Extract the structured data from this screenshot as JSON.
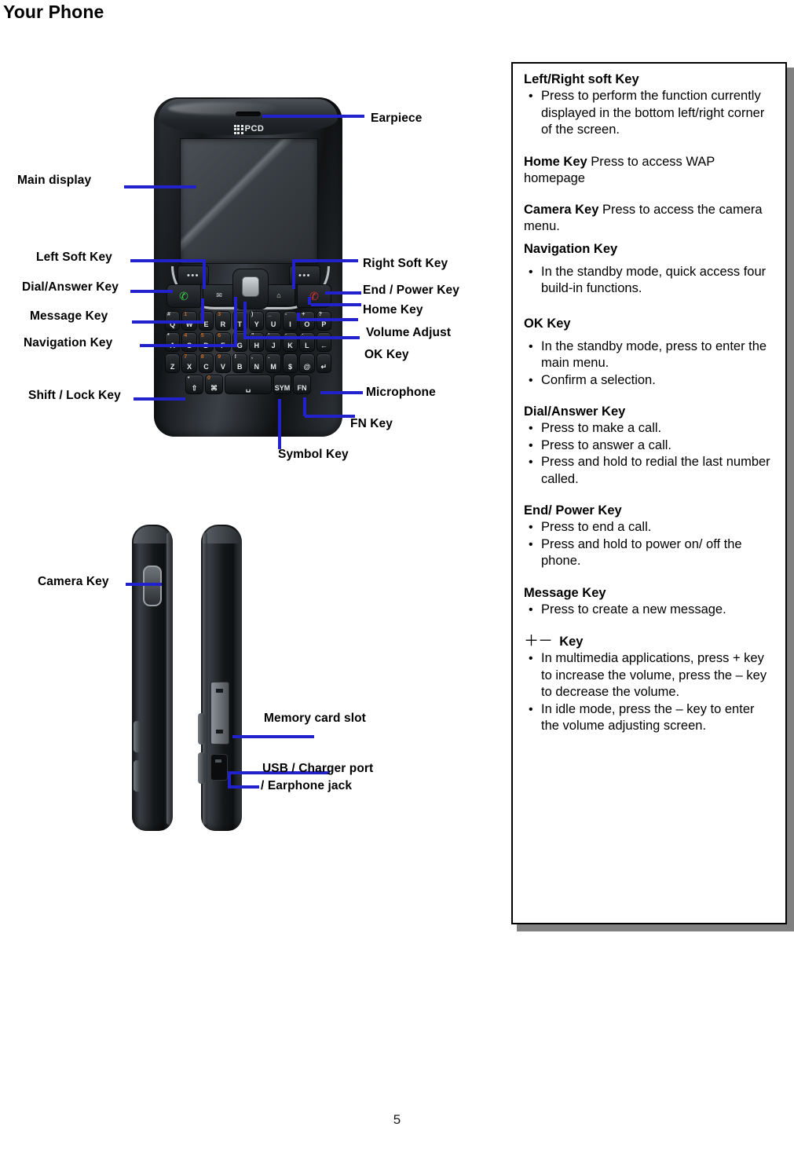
{
  "page": {
    "title": "Your Phone",
    "page_number": "5"
  },
  "phone_brand": "PCD",
  "front_callouts": [
    {
      "label": "Earpiece"
    },
    {
      "label": "Main display"
    },
    {
      "label": "Left Soft Key"
    },
    {
      "label": "Dial/Answer Key"
    },
    {
      "label": "Message Key"
    },
    {
      "label": "Navigation Key"
    },
    {
      "label": "Shift / Lock Key"
    },
    {
      "label": "Right Soft Key"
    },
    {
      "label": "End / Power Key"
    },
    {
      "label": "Home Key"
    },
    {
      "label": "Volume Adjust"
    },
    {
      "label": "OK Key"
    },
    {
      "label": "Microphone"
    },
    {
      "label": "FN Key"
    },
    {
      "label": "Symbol Key"
    }
  ],
  "side_callouts": [
    {
      "label": "Camera Key"
    },
    {
      "label": "Memory card slot"
    },
    {
      "label": "USB / Charger port"
    },
    {
      "label": "/ Earphone jack"
    }
  ],
  "keyboard": {
    "row1": [
      {
        "alt": "#",
        "alt_color": "white",
        "main": "Q"
      },
      {
        "alt": "1",
        "alt_color": "orange",
        "main": "W"
      },
      {
        "alt": "2",
        "alt_color": "orange",
        "main": "E"
      },
      {
        "alt": "3",
        "alt_color": "orange",
        "main": "R"
      },
      {
        "alt": "(",
        "alt_color": "white",
        "main": "T"
      },
      {
        "alt": ")",
        "alt_color": "white",
        "main": "Y"
      },
      {
        "alt": "_",
        "alt_color": "white",
        "main": "U"
      },
      {
        "alt": "-",
        "alt_color": "white",
        "main": "I"
      },
      {
        "alt": "+",
        "alt_color": "white",
        "main": "O"
      },
      {
        "alt": "?",
        "alt_color": "white",
        "main": "P"
      }
    ],
    "row2": [
      {
        "alt": "*",
        "alt_color": "white",
        "main": "A"
      },
      {
        "alt": "4",
        "alt_color": "orange",
        "main": "S"
      },
      {
        "alt": "5",
        "alt_color": "orange",
        "main": "D"
      },
      {
        "alt": "6",
        "alt_color": "orange",
        "main": "F"
      },
      {
        "alt": "/",
        "alt_color": "white",
        "main": "G"
      },
      {
        "alt": "\"",
        "alt_color": "white",
        "main": "H"
      },
      {
        "alt": "'",
        "alt_color": "white",
        "main": "J"
      },
      {
        "alt": ":",
        "alt_color": "white",
        "main": "K"
      },
      {
        "alt": ";",
        "alt_color": "white",
        "main": "L"
      },
      {
        "alt": "",
        "alt_color": "white",
        "main": "←"
      }
    ],
    "row3": [
      {
        "alt": "",
        "alt_color": "white",
        "main": "Z"
      },
      {
        "alt": "7",
        "alt_color": "orange",
        "main": "X"
      },
      {
        "alt": "8",
        "alt_color": "orange",
        "main": "C"
      },
      {
        "alt": "9",
        "alt_color": "orange",
        "main": "V"
      },
      {
        "alt": "!",
        "alt_color": "white",
        "main": "B"
      },
      {
        "alt": ",",
        "alt_color": "white",
        "main": "N"
      },
      {
        "alt": ".",
        "alt_color": "white",
        "main": "M"
      },
      {
        "alt": "",
        "alt_color": "white",
        "main": "$"
      },
      {
        "alt": "",
        "alt_color": "white",
        "main": "@"
      },
      {
        "alt": "",
        "alt_color": "white",
        "main": "↵"
      }
    ],
    "row4": [
      {
        "alt": "•",
        "alt_color": "white",
        "main": "⇧"
      },
      {
        "alt": "0",
        "alt_color": "orange",
        "main": "⌘"
      },
      {
        "alt": "",
        "alt_color": "white",
        "main": "␣"
      },
      {
        "alt": "",
        "alt_color": "white",
        "main": "SYM"
      },
      {
        "alt": "",
        "alt_color": "white",
        "main": "FN"
      }
    ]
  },
  "info_box": {
    "sections": [
      {
        "heading": "Left/Right soft Key",
        "bullets": [
          "Press to perform the function currently displayed in the bottom left/right corner of the screen."
        ]
      },
      {
        "inline_heading": "Home Key",
        "inline_text": " Press to access WAP homepage"
      },
      {
        "inline_heading": "Camera Key",
        "inline_text": " Press to access the camera menu."
      },
      {
        "heading": "Navigation Key",
        "bullets": [
          "In the standby mode, quick access four build-in functions."
        ]
      },
      {
        "heading": "OK Key",
        "bullets": [
          "In the standby mode, press to enter the main menu.",
          "Confirm a selection."
        ]
      },
      {
        "heading": "Dial/Answer Key",
        "bullets": [
          "Press to make a call.",
          "Press to answer a call.",
          "Press and hold to redial the last number called."
        ]
      },
      {
        "heading": "End/ Power Key",
        "bullets": [
          "Press to end a call.",
          "Press and hold to power on/ off the phone."
        ]
      },
      {
        "heading": "Message Key",
        "bullets": [
          "Press to create a new message."
        ]
      },
      {
        "heading_symbol": "＋－",
        "heading": "Key",
        "bullets": [
          "In multimedia applications, press + key to increase the volume, press the – key to decrease the volume.",
          "In idle mode, press the – key to enter the volume adjusting screen."
        ]
      }
    ]
  },
  "colors": {
    "leader_line": "#2222cc",
    "box_border": "#000000",
    "box_shadow": "#808080"
  }
}
